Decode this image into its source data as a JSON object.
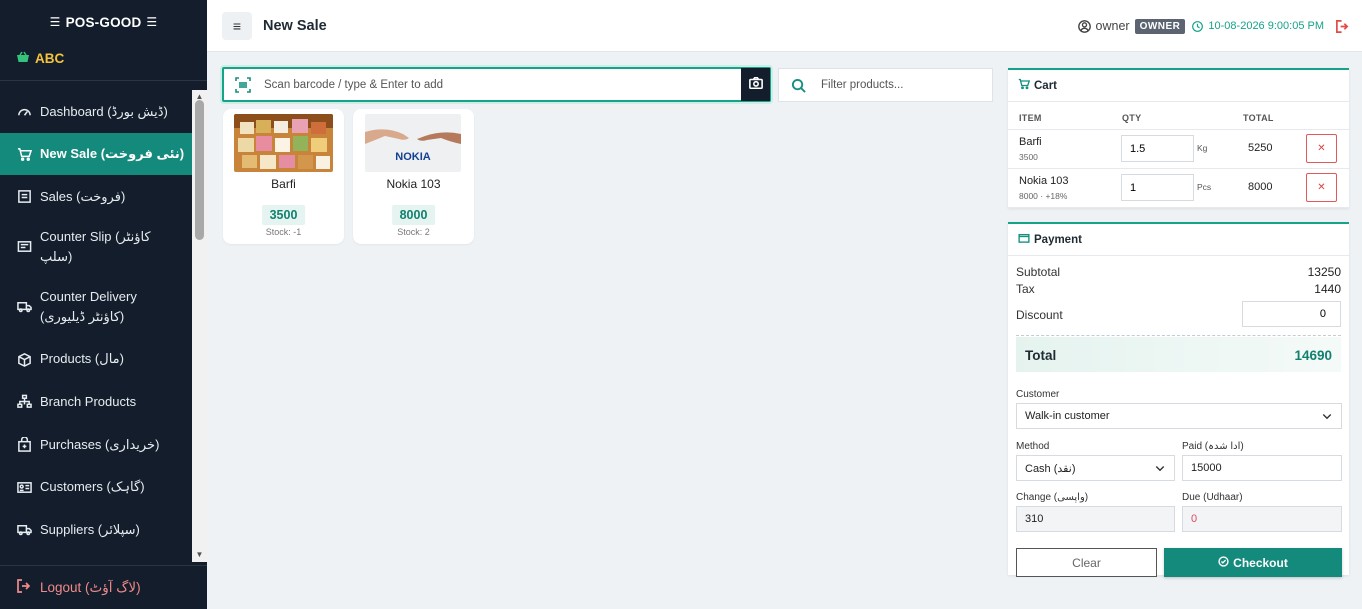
{
  "app": {
    "brand": "POS-GOOD",
    "org": "ABC"
  },
  "sidebar": {
    "items": [
      {
        "label": "Dashboard (ڈیش بورڈ)",
        "icon": "gauge-icon"
      },
      {
        "label": "New Sale (نئی فروخت)",
        "icon": "cart-icon",
        "active": true
      },
      {
        "label": "Sales (فروخت)",
        "icon": "receipt-icon"
      },
      {
        "label": "Counter Slip (کاؤنٹر سلپ)",
        "icon": "slip-icon"
      },
      {
        "label": "Counter Delivery (کاؤنٹر ڈیلیوری)",
        "icon": "truck-icon"
      },
      {
        "label": "Products (مال)",
        "icon": "box-icon"
      },
      {
        "label": "Branch Products",
        "icon": "sitemap-icon"
      },
      {
        "label": "Purchases (خریداری)",
        "icon": "bag-icon"
      },
      {
        "label": "Customers (گاہک)",
        "icon": "id-card-icon"
      },
      {
        "label": "Suppliers (سپلائر)",
        "icon": "truck-icon"
      }
    ],
    "logout_label": "Logout (لاگ آؤٹ)"
  },
  "header": {
    "title": "New Sale",
    "user": "owner",
    "role": "OWNER",
    "datetime": "10-08-2026 9:00:05 PM"
  },
  "scan": {
    "placeholder": "Scan barcode / type & Enter to add"
  },
  "filter": {
    "placeholder": "Filter products..."
  },
  "products": [
    {
      "name": "Barfi",
      "price": "3500",
      "stock": "Stock: -1",
      "image": "barfi-image"
    },
    {
      "name": "Nokia 103",
      "price": "8000",
      "stock": "Stock: 2",
      "image": "nokia-image"
    }
  ],
  "cart": {
    "title": "Cart",
    "columns": {
      "item": "ITEM",
      "qty": "QTY",
      "total": "TOTAL"
    },
    "rows": [
      {
        "name": "Barfi",
        "sub": "3500",
        "qty": "1.5",
        "unit": "Kg",
        "total": "5250"
      },
      {
        "name": "Nokia 103",
        "sub": "8000 · +18%",
        "qty": "1",
        "unit": "Pcs",
        "total": "8000"
      }
    ]
  },
  "payment": {
    "title": "Payment",
    "subtotal_label": "Subtotal",
    "subtotal": "13250",
    "tax_label": "Tax",
    "tax": "1440",
    "discount_label": "Discount",
    "discount": "0",
    "total_label": "Total",
    "total": "14690",
    "customer_label": "Customer",
    "customer": "Walk-in customer",
    "method_label": "Method",
    "method": "Cash (نقد)",
    "paid_label": "Paid (ادا شدہ)",
    "paid": "15000",
    "change_label": "Change (واپسی)",
    "change": "310",
    "due_label": "Due (Udhaar)",
    "due": "0",
    "clear_label": "Clear",
    "checkout_label": "Checkout"
  },
  "colors": {
    "accent": "#138a7c",
    "sidebar_bg": "#131d2b",
    "danger": "#d94444"
  }
}
